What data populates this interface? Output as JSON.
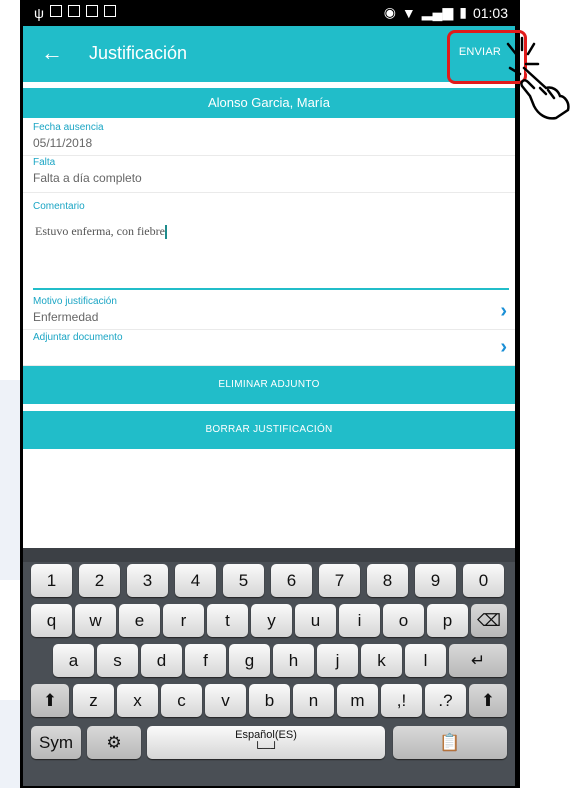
{
  "statusbar": {
    "time": "01:03"
  },
  "appbar": {
    "back_glyph": "←",
    "title": "Justificación",
    "send_label": "ENVIAR"
  },
  "student_name": "Alonso Garcia, María",
  "fields": {
    "absence_date": {
      "label": "Fecha ausencia",
      "value": "05/11/2018"
    },
    "absence_type": {
      "label": "Falta",
      "value": "Falta a día completo"
    },
    "comment": {
      "label": "Comentario",
      "value": "Estuvo enferma, con fiebre"
    },
    "reason": {
      "label": "Motivo justificación",
      "value": "Enfermedad"
    },
    "attach": {
      "label": "Adjuntar documento"
    }
  },
  "buttons": {
    "remove_attachment": "ELIMINAR ADJUNTO",
    "delete_justification": "BORRAR JUSTIFICACIÓN"
  },
  "keyboard": {
    "row_numbers": [
      "1",
      "2",
      "3",
      "4",
      "5",
      "6",
      "7",
      "8",
      "9",
      "0"
    ],
    "row1": [
      "q",
      "w",
      "e",
      "r",
      "t",
      "y",
      "u",
      "i",
      "o",
      "p"
    ],
    "row2": [
      "a",
      "s",
      "d",
      "f",
      "g",
      "h",
      "j",
      "k",
      "l"
    ],
    "row3": [
      "z",
      "x",
      "c",
      "v",
      "b",
      "n",
      "m"
    ],
    "sym": "Sym",
    "space_label": "Español(ES)"
  },
  "colors": {
    "accent": "#21bdc9",
    "chevron": "#1a8fd6",
    "callout": "#e11b1b"
  }
}
